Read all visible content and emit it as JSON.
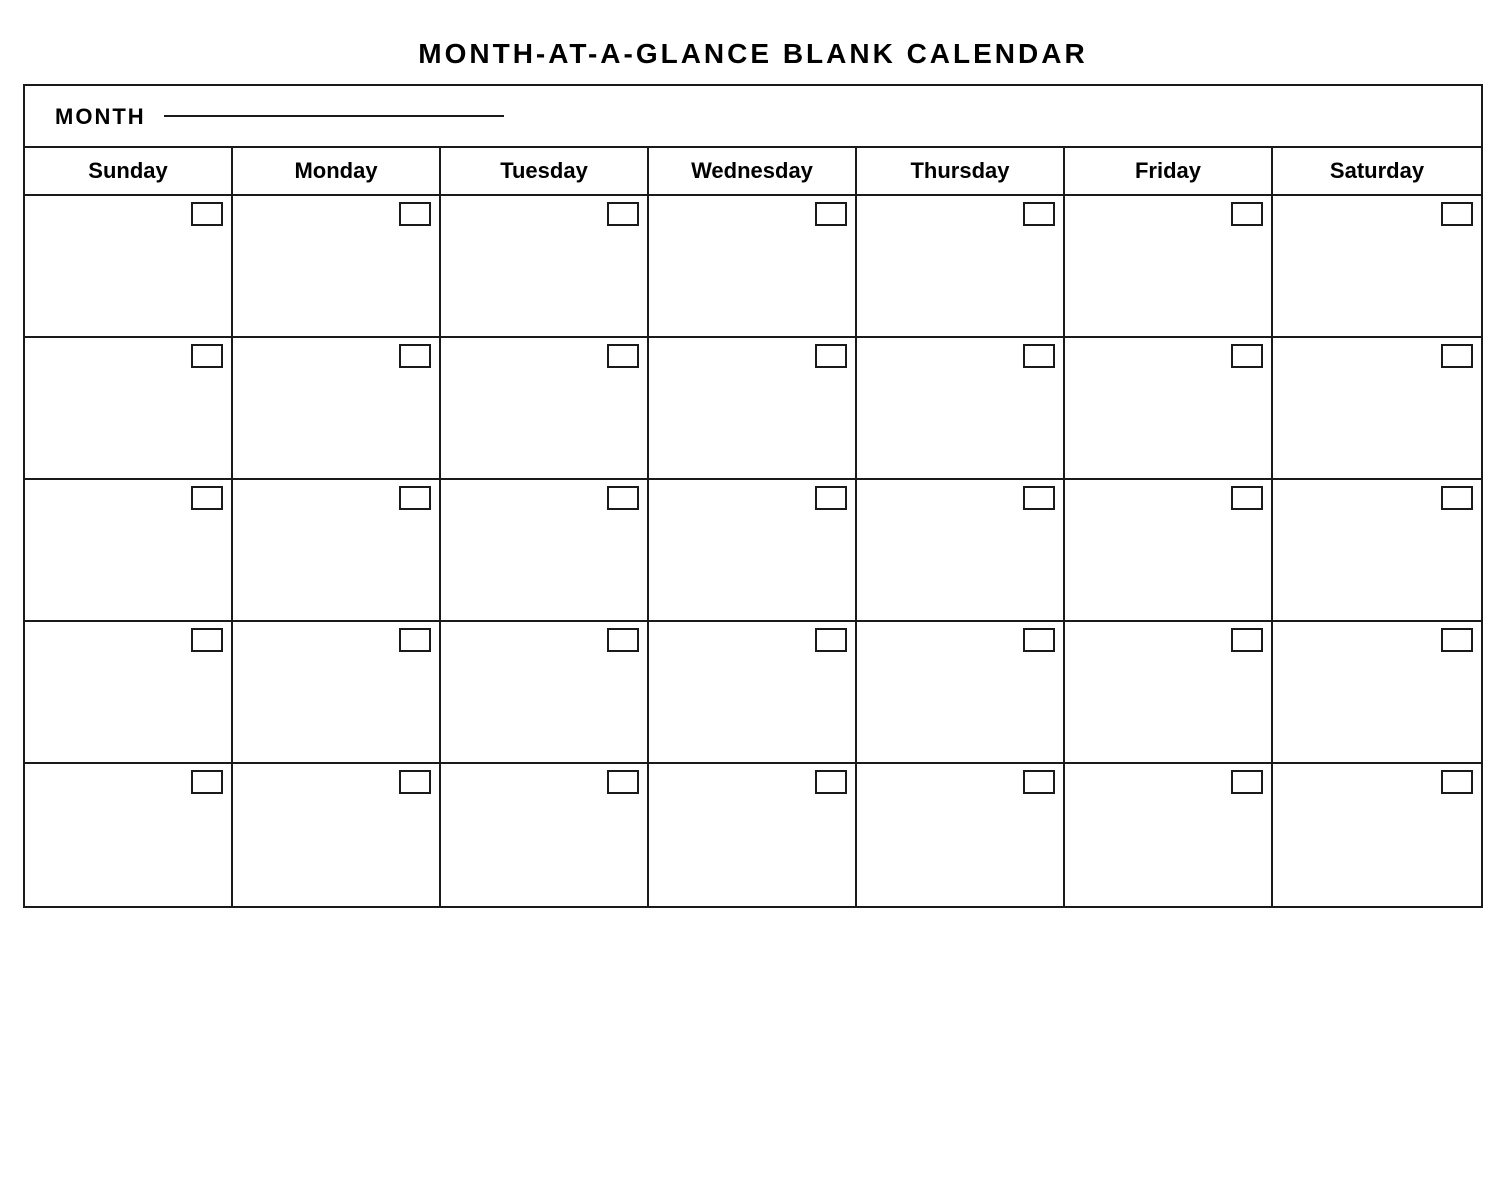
{
  "title": "MONTH-AT-A-GLANCE  BLANK  CALENDAR",
  "month_label": "MONTH",
  "days": [
    {
      "label": "Sunday"
    },
    {
      "label": "Monday"
    },
    {
      "label": "Tuesday"
    },
    {
      "label": "Wednesday"
    },
    {
      "label": "Thursday"
    },
    {
      "label": "Friday"
    },
    {
      "label": "Saturday"
    }
  ],
  "weeks": [
    {
      "id": "week-1"
    },
    {
      "id": "week-2"
    },
    {
      "id": "week-3"
    },
    {
      "id": "week-4"
    },
    {
      "id": "week-5"
    }
  ]
}
